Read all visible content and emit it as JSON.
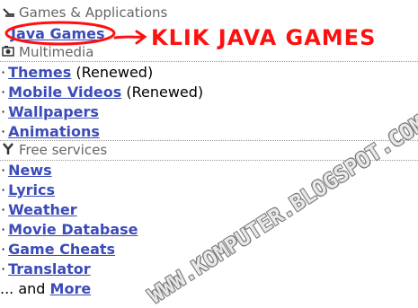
{
  "sections": {
    "games": {
      "header": "Games & Applications",
      "link": "Java Games"
    },
    "multimedia": {
      "header": "Multimedia",
      "items": [
        {
          "label": "Themes",
          "note": "(Renewed)"
        },
        {
          "label": "Mobile Videos",
          "note": "(Renewed)"
        },
        {
          "label": "Wallpapers"
        },
        {
          "label": "Animations"
        }
      ]
    },
    "free_services": {
      "header": "Free services",
      "items": [
        {
          "label": "News"
        },
        {
          "label": "Lyrics"
        },
        {
          "label": "Weather"
        },
        {
          "label": "Movie Database"
        },
        {
          "label": "Game Cheats"
        },
        {
          "label": "Translator"
        }
      ],
      "more_prefix": "... and",
      "more_link": "More"
    }
  },
  "annotation": {
    "text": "KLIK JAVA GAMES"
  },
  "watermark": {
    "text": "WWW.KOMPUTER.BLOGSPOT.COM"
  },
  "colors": {
    "link": "#3b4bb8",
    "header_text": "#666666",
    "annotation": "#ff1010"
  },
  "icons": [
    "games-icon",
    "multimedia-icon",
    "tools-icon"
  ]
}
